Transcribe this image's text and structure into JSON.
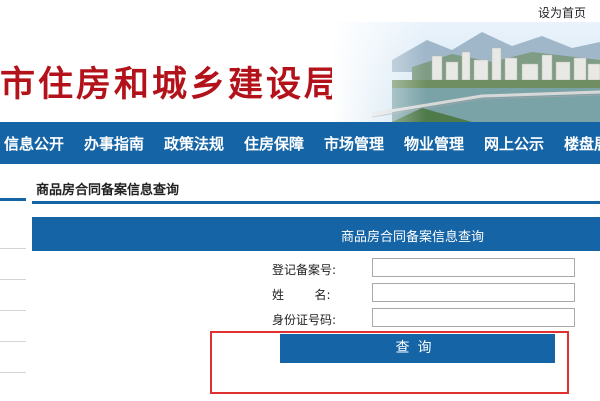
{
  "header": {
    "set_homepage": "设为首页",
    "site_title": "市住房和城乡建设局"
  },
  "nav": {
    "items": [
      "信息公开",
      "办事指南",
      "政策法规",
      "住房保障",
      "市场管理",
      "物业管理",
      "网上公示",
      "楼盘展"
    ]
  },
  "page": {
    "title": "商品房合同备案信息查询"
  },
  "form": {
    "header": "商品房合同备案信息查询",
    "fields": {
      "record_no": {
        "label": "登记备案号:",
        "value": ""
      },
      "name": {
        "label": "姓        名:",
        "value": ""
      },
      "id_no": {
        "label": "身份证号码:",
        "value": ""
      }
    },
    "submit_label": "查询"
  },
  "colors": {
    "primary_blue": "#1564a6",
    "title_red": "#b3121a",
    "highlight_red": "#e03131"
  }
}
